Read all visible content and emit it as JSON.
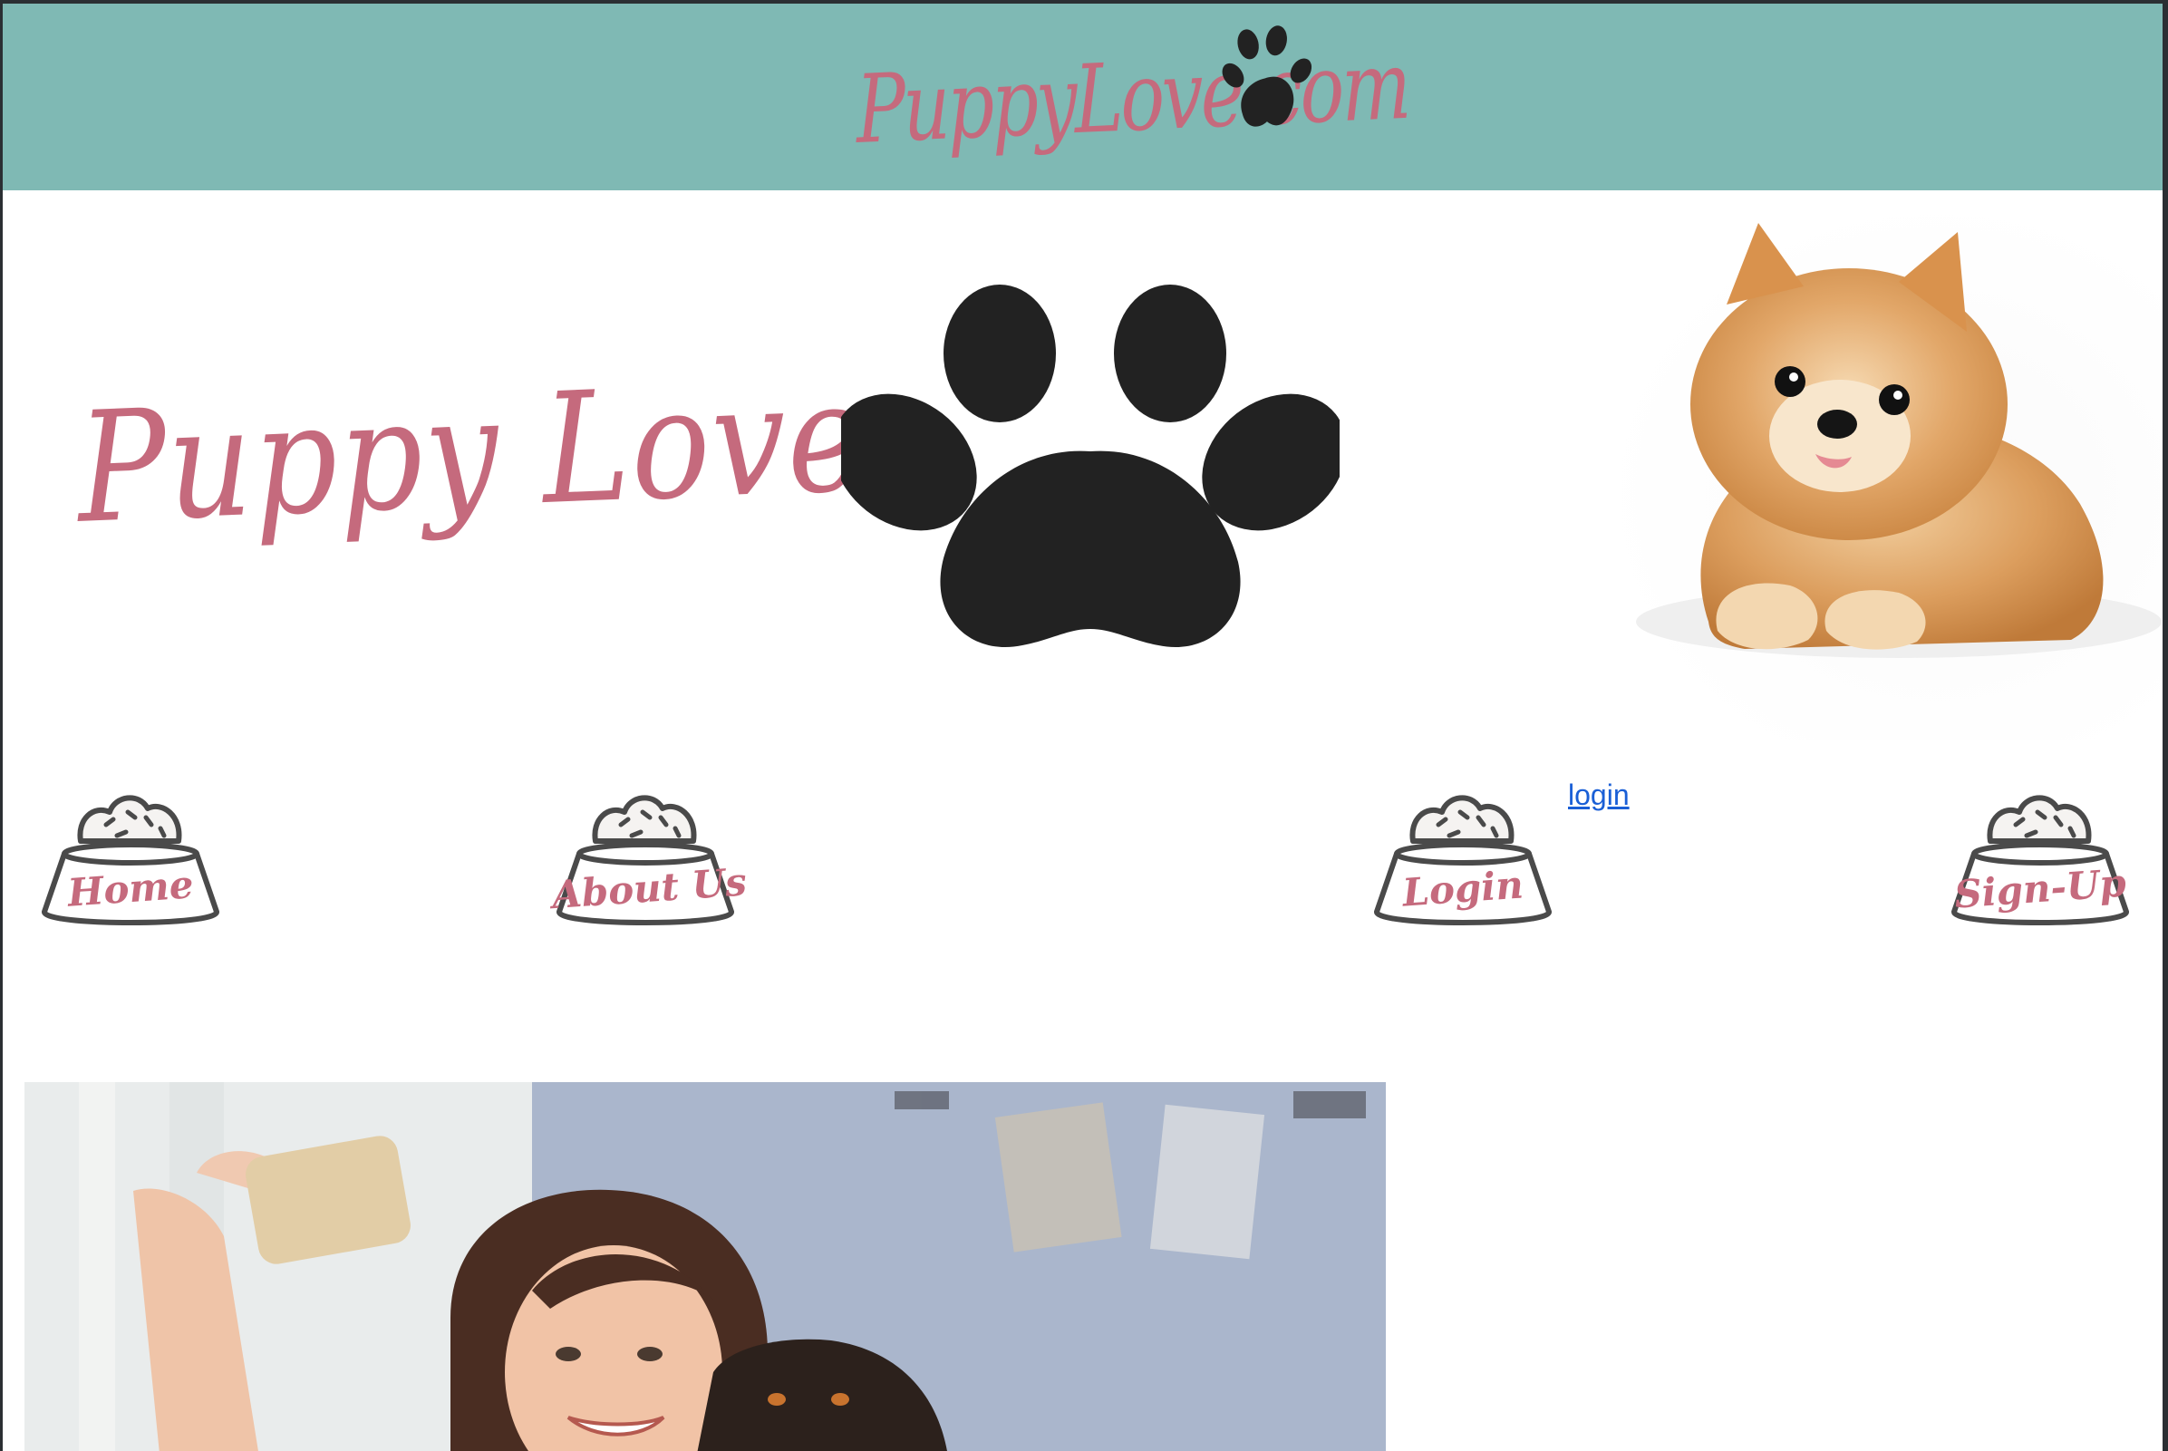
{
  "site": {
    "logo_text": "PuppyLove.com",
    "hero_title": "Puppy Love"
  },
  "nav": {
    "items": [
      {
        "label": "Home"
      },
      {
        "label": "About Us"
      },
      {
        "label": "Login"
      },
      {
        "label": "Sign-Up"
      }
    ],
    "text_link": "login"
  },
  "colors": {
    "header_bg": "#7fb9b4",
    "accent_pink": "#c56a7d",
    "paw": "#222222",
    "link_blue": "#1a5fd6"
  },
  "icons": {
    "header_paw": "paw-print-icon",
    "hero_paw": "paw-print-icon",
    "nav_bowl": "dog-food-bowl-icon"
  },
  "images": {
    "hero_dog": "pomeranian-puppy-photo",
    "feature": "woman-selfie-with-dog-photo"
  }
}
